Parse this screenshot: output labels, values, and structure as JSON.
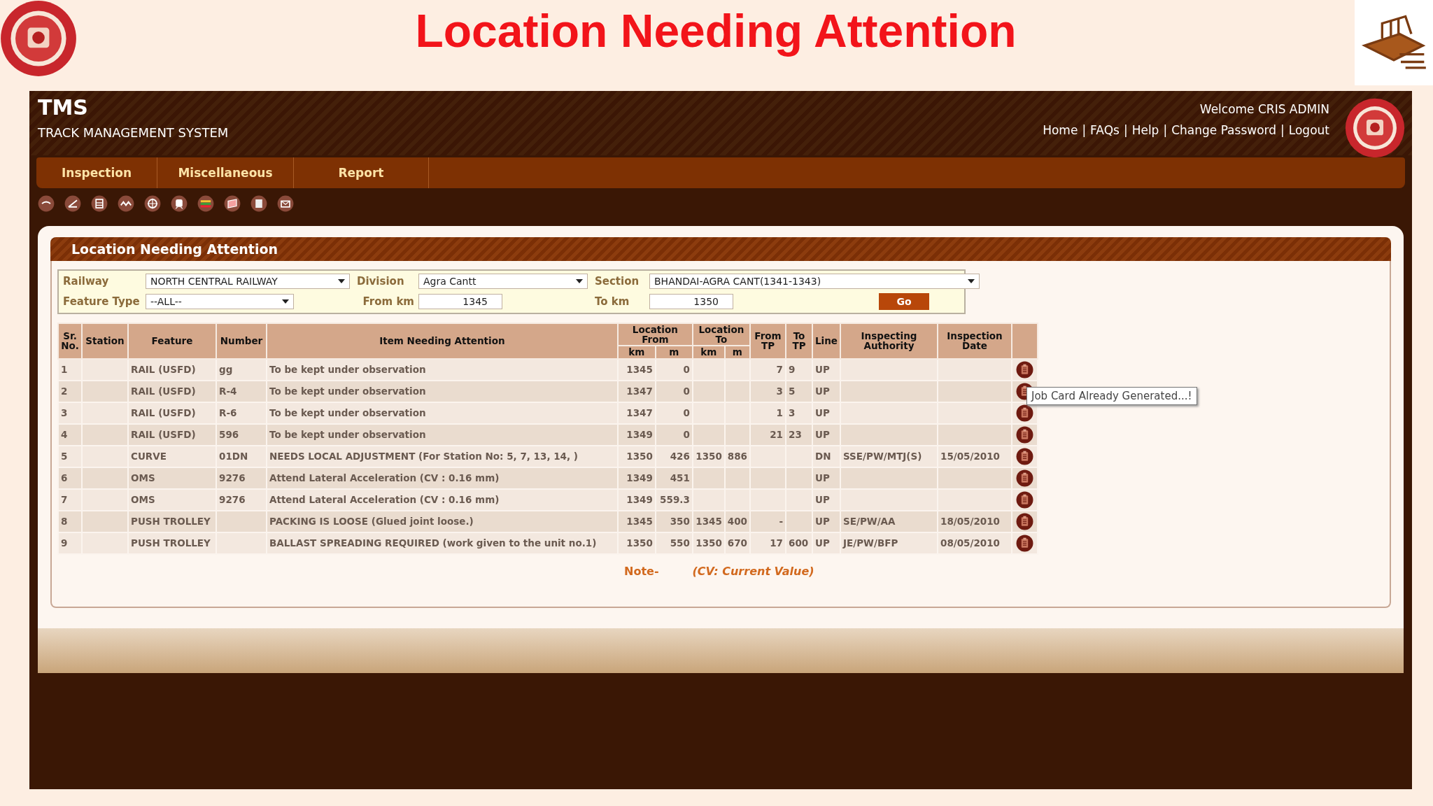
{
  "slide_title": "Location Needing Attention",
  "header": {
    "app_name": "TMS",
    "app_subtitle": "TRACK MANAGEMENT SYSTEM",
    "welcome": "Welcome CRIS ADMIN",
    "links": [
      {
        "label": "Home"
      },
      {
        "separator": "|",
        "label": "FAQs"
      },
      {
        "separator": "|",
        "label": "Help"
      },
      {
        "separator": "|",
        "label": "Change Password"
      },
      {
        "separator": "|",
        "label": "Logout"
      }
    ]
  },
  "menu": [
    {
      "label": "Inspection"
    },
    {
      "label": "Miscellaneous"
    },
    {
      "label": "Report"
    }
  ],
  "panel": {
    "title": "Location Needing Attention",
    "filters": {
      "railway": {
        "label": "Railway",
        "value": "NORTH CENTRAL RAILWAY"
      },
      "division": {
        "label": "Division",
        "value": "Agra Cantt"
      },
      "section": {
        "label": "Section",
        "value": "BHANDAI-AGRA CANT(1341-1343)"
      },
      "feature_type": {
        "label": "Feature Type",
        "value": "--ALL--"
      },
      "from_km": {
        "label": "From km",
        "value": "1345"
      },
      "to_km": {
        "label": "To km",
        "value": "1350"
      },
      "go_button": "Go"
    },
    "table": {
      "columns": [
        {
          "label": "Sr. No."
        },
        {
          "label": "Station"
        },
        {
          "label": "Feature"
        },
        {
          "label": "Number"
        },
        {
          "label": "Item Needing Attention"
        },
        {
          "label": "Location From",
          "sub": [
            "km",
            "m"
          ]
        },
        {
          "label": "Location To",
          "sub": [
            "km",
            "m"
          ]
        },
        {
          "label": "From TP"
        },
        {
          "label": "To TP"
        },
        {
          "label": "Line"
        },
        {
          "label": "Inspecting Authority"
        },
        {
          "label": "Inspection Date"
        }
      ],
      "rows": [
        {
          "sr": "1",
          "feature": "RAIL (USFD)",
          "number": "gg",
          "item": "To be kept under observation",
          "from_km": "1345",
          "from_m": "0",
          "from_tp": "7",
          "to_tp": "9",
          "line": "UP"
        },
        {
          "sr": "2",
          "feature": "RAIL (USFD)",
          "number": "R-4",
          "item": "To be kept under observation",
          "from_km": "1347",
          "from_m": "0",
          "from_tp": "3",
          "to_tp": "5",
          "line": "UP"
        },
        {
          "sr": "3",
          "feature": "RAIL (USFD)",
          "number": "R-6",
          "item": "To be kept under observation",
          "from_km": "1347",
          "from_m": "0",
          "from_tp": "1",
          "to_tp": "3",
          "line": "UP"
        },
        {
          "sr": "4",
          "feature": "RAIL (USFD)",
          "number": "596",
          "item": "To be kept under observation",
          "from_km": "1349",
          "from_m": "0",
          "from_tp": "21",
          "to_tp": "23",
          "line": "UP"
        },
        {
          "sr": "5",
          "feature": "CURVE",
          "number": "01DN",
          "item": "NEEDS LOCAL ADJUSTMENT (For Station No: 5, 7, 13, 14, )",
          "from_km": "1350",
          "from_m": "426",
          "to_km": "1350",
          "to_m": "886",
          "line": "DN",
          "authority": "SSE/PW/MTJ(S)",
          "date": "15/05/2010"
        },
        {
          "sr": "6",
          "feature": "OMS",
          "number": "9276",
          "item": "Attend Lateral Acceleration (CV : 0.16 mm)",
          "from_km": "1349",
          "from_m": "451",
          "line": "UP"
        },
        {
          "sr": "7",
          "feature": "OMS",
          "number": "9276",
          "item": "Attend Lateral Acceleration (CV : 0.16 mm)",
          "from_km": "1349",
          "from_m": "559.3",
          "line": "UP"
        },
        {
          "sr": "8",
          "feature": "PUSH TROLLEY",
          "item": "PACKING IS LOOSE (Glued joint loose.)",
          "from_km": "1345",
          "from_m": "350",
          "to_km": "1345",
          "to_m": "400",
          "from_tp": "-",
          "line": "UP",
          "authority": "SE/PW/AA",
          "date": "18/05/2010"
        },
        {
          "sr": "9",
          "feature": "PUSH TROLLEY",
          "item": "BALLAST SPREADING REQUIRED (work given to the unit no.1)",
          "from_km": "1350",
          "from_m": "550",
          "to_km": "1350",
          "to_m": "670",
          "from_tp": "17",
          "to_tp": "600",
          "line": "UP",
          "authority": "JE/PW/BFP",
          "date": "08/05/2010"
        }
      ]
    },
    "tooltip": "Job Card Already Generated...!",
    "note": {
      "label": "Note-",
      "text": "(CV: Current Value)"
    }
  }
}
